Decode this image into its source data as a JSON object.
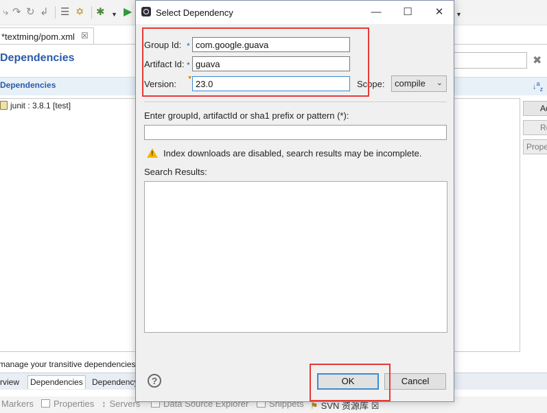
{
  "ide": {
    "editor_tab": "*textming/pom.xml",
    "editor_tab_close": "☒",
    "page_title": "Dependencies",
    "section_title": "Dependencies",
    "dependency_items": [
      "junit : 3.8.1 [test]"
    ],
    "side_buttons": [
      "Add...",
      "Remove",
      "Properties..."
    ],
    "transitive_hint": "manage your transitive dependencies",
    "bottom_tabs": [
      {
        "label": "Overview"
      },
      {
        "label": "Dependencies",
        "active": true
      },
      {
        "label": "Dependency Hierarchy"
      }
    ],
    "views": [
      "Markers",
      "Properties",
      "Servers",
      "Data Source Explorer",
      "Snippets",
      "SVN 资源库"
    ],
    "views_close": "☒"
  },
  "dialog": {
    "title": "Select Dependency",
    "group_id_label": "Group Id:",
    "group_id_value": "com.google.guava",
    "artifact_id_label": "Artifact Id:",
    "artifact_id_value": "guava",
    "version_label": "Version:",
    "version_value": "23.0",
    "scope_label": "Scope:",
    "scope_value": "compile",
    "required_marker": "*",
    "search_label": "Enter groupId, artifactId or sha1 prefix or pattern (*):",
    "search_value": "",
    "warning_text": "Index downloads are disabled, search results may be incomplete.",
    "results_label": "Search Results:",
    "ok_label": "OK",
    "cancel_label": "Cancel",
    "help_label": "?"
  },
  "colors": {
    "highlight": "#e53935",
    "link_blue": "#2a5aa8",
    "focus_blue": "#3c8bd0",
    "warning": "#f2b705"
  }
}
